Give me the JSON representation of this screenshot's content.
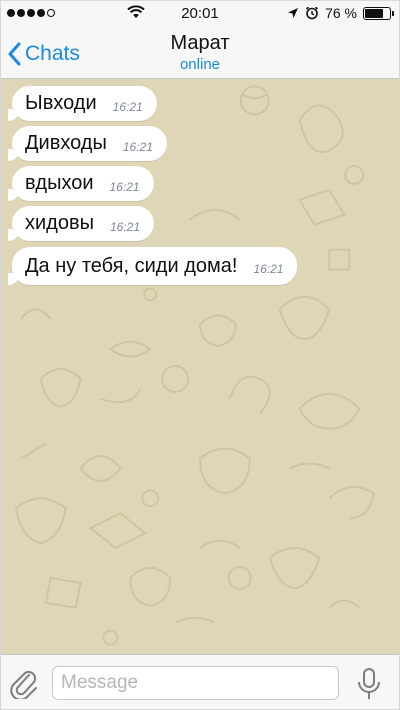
{
  "status_bar": {
    "signal_dots_filled": 4,
    "signal_dots_total": 5,
    "time": "20:01",
    "battery_text": "76 %",
    "battery_level": 0.76,
    "icons": [
      "wifi-icon",
      "location-arrow-icon",
      "alarm-icon",
      "battery-icon"
    ]
  },
  "nav": {
    "back_label": "Chats",
    "title": "Марат",
    "subtitle": "online",
    "back_icon": "chevron-left-icon"
  },
  "messages": [
    {
      "text": "Ывходи",
      "time": "16:21"
    },
    {
      "text": "Дивходы",
      "time": "16:21"
    },
    {
      "text": "вдыхои",
      "time": "16:21"
    },
    {
      "text": "хидовы",
      "time": "16:21"
    },
    {
      "text": "Да ну тебя, сиди дома!",
      "time": "16:21"
    }
  ],
  "input_bar": {
    "placeholder": "Message",
    "value": "",
    "attach_icon": "paperclip-icon",
    "mic_icon": "microphone-icon"
  },
  "colors": {
    "accent": "#1a8ae6",
    "chat_background": "#dfd5b7",
    "bubble": "#ffffff",
    "bar_background": "#f7f7f8"
  }
}
